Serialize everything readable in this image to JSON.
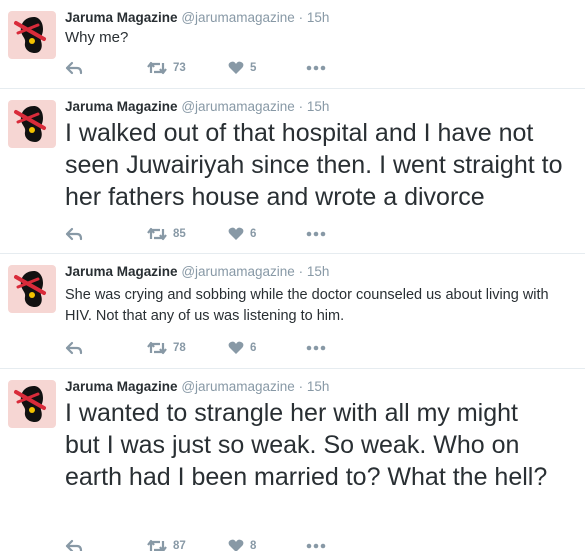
{
  "tweets": [
    {
      "name": "Jaruma Magazine",
      "handle": "@jarumamagazine",
      "separator": "·",
      "time": "15h",
      "text": "Why me?",
      "retweets": "73",
      "likes": "5",
      "icons": {
        "reply": "reply-icon",
        "retweet": "retweet-icon",
        "like": "heart-icon",
        "more": "more-icon"
      }
    },
    {
      "name": "Jaruma Magazine",
      "handle": "@jarumamagazine",
      "separator": "·",
      "time": "15h",
      "text": "I walked out of that hospital and I have not seen Juwairiyah since then. I went straight to her fathers house and wrote a divorce",
      "retweets": "85",
      "likes": "6",
      "icons": {
        "reply": "reply-icon",
        "retweet": "retweet-icon",
        "like": "heart-icon",
        "more": "more-icon"
      }
    },
    {
      "name": "Jaruma Magazine",
      "handle": "@jarumamagazine",
      "separator": "·",
      "time": "15h",
      "text": "She was crying and sobbing while the doctor counseled us about living with HIV. Not that any of us was listening to him.",
      "retweets": "78",
      "likes": "6",
      "icons": {
        "reply": "reply-icon",
        "retweet": "retweet-icon",
        "like": "heart-icon",
        "more": "more-icon"
      }
    },
    {
      "name": "Jaruma Magazine",
      "handle": "@jarumamagazine",
      "separator": "·",
      "time": "15h",
      "text": "I wanted to strangle her with all my might but I was just so weak. So weak. Who on earth had I been married to? What the hell?",
      "retweets": "87",
      "likes": "8",
      "icons": {
        "reply": "reply-icon",
        "retweet": "retweet-icon",
        "like": "heart-icon",
        "more": "more-icon"
      }
    }
  ],
  "colors": {
    "text": "#292f33",
    "muted": "#8899a6",
    "divider": "#e6ecf0",
    "avatar_bg": "#f6d6d3",
    "avatar_red": "#d92b3a"
  }
}
